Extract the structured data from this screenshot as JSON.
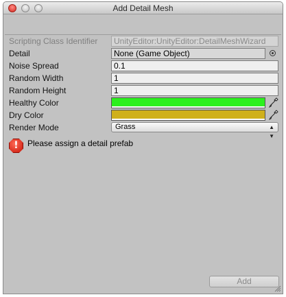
{
  "window": {
    "title": "Add Detail Mesh"
  },
  "fields": {
    "scripting_class": {
      "label": "Scripting Class Identifier",
      "value": "UnityEditor:UnityEditor:DetailMeshWizard"
    },
    "detail": {
      "label": "Detail",
      "value": "None (Game Object)"
    },
    "noise_spread": {
      "label": "Noise Spread",
      "value": "0.1"
    },
    "random_width": {
      "label": "Random Width",
      "value": "1"
    },
    "random_height": {
      "label": "Random Height",
      "value": "1"
    },
    "healthy_color": {
      "label": "Healthy Color",
      "color": "#2cf01e"
    },
    "dry_color": {
      "label": "Dry Color",
      "color": "#cfb01b"
    },
    "render_mode": {
      "label": "Render Mode",
      "value": "Grass"
    }
  },
  "help": {
    "message": "Please assign a detail prefab",
    "icon": "error-icon"
  },
  "actions": {
    "add_label": "Add"
  },
  "colors": {
    "window_bg": "#c2c2c2",
    "close_button": "#d6281f",
    "error_icon": "#c8170a"
  }
}
